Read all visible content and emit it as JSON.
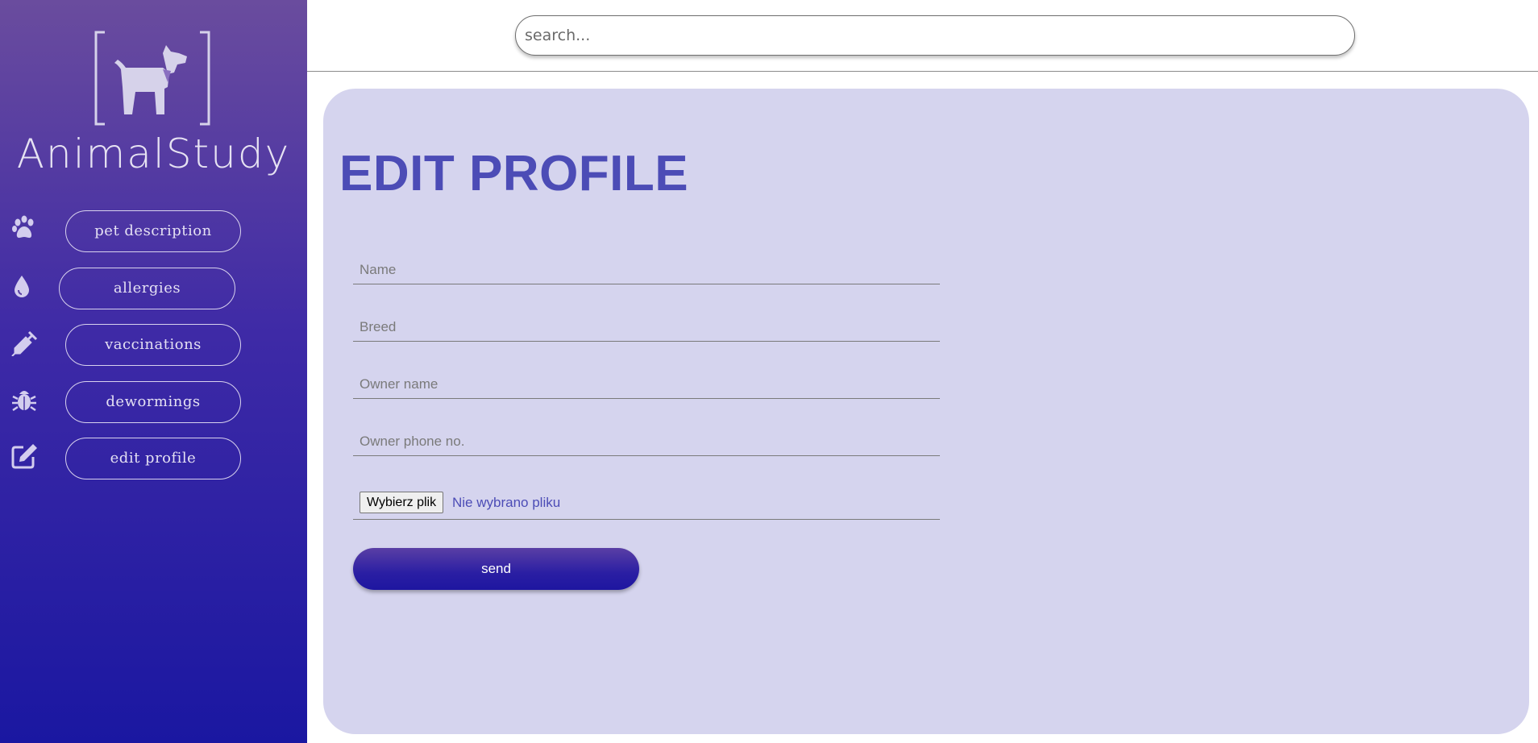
{
  "app": {
    "name": "AnimalStudy",
    "logo_icon": "dog-in-brackets-icon"
  },
  "search": {
    "placeholder": "search..."
  },
  "sidebar": {
    "items": [
      {
        "label": "pet description",
        "icon": "paw-icon"
      },
      {
        "label": "allergies",
        "icon": "droplet-icon"
      },
      {
        "label": "vaccinations",
        "icon": "syringe-icon"
      },
      {
        "label": "dewormings",
        "icon": "bug-icon"
      },
      {
        "label": "edit profile",
        "icon": "edit-icon"
      }
    ]
  },
  "main": {
    "title": "EDIT PROFILE",
    "fields": {
      "name_placeholder": "Name",
      "breed_placeholder": "Breed",
      "owner_name_placeholder": "Owner name",
      "owner_phone_placeholder": "Owner phone no."
    },
    "file": {
      "button_label": "Wybierz plik",
      "status": "Nie wybrano pliku"
    },
    "send_label": "send"
  },
  "colors": {
    "sidebar_top": "#6a4c9e",
    "sidebar_bottom": "#1a17a1",
    "card_background": "#d5d4ee",
    "title_color": "#4c4cb6"
  }
}
